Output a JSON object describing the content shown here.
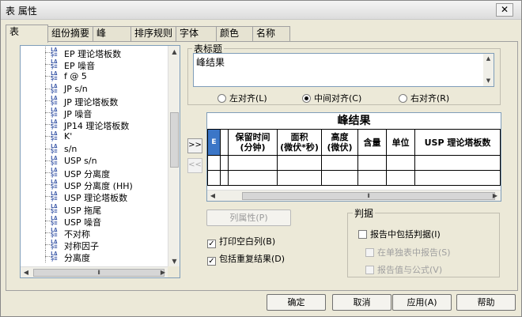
{
  "window": {
    "title": "表 属性",
    "close": "✕"
  },
  "tabs": [
    {
      "label": "表"
    },
    {
      "label": "组份摘要"
    },
    {
      "label": "峰"
    },
    {
      "label": "排序规则"
    },
    {
      "label": "字体"
    },
    {
      "label": "颜色"
    },
    {
      "label": "名称"
    }
  ],
  "tree": {
    "items": [
      {
        "label": "EP 理论塔板数"
      },
      {
        "label": "EP 噪音"
      },
      {
        "label": "f @ 5"
      },
      {
        "label": "JP s/n"
      },
      {
        "label": "JP 理论塔板数"
      },
      {
        "label": "JP 噪音"
      },
      {
        "label": "JP14 理论塔板数"
      },
      {
        "label": "K'"
      },
      {
        "label": "s/n"
      },
      {
        "label": "USP s/n"
      },
      {
        "label": "USP 分离度"
      },
      {
        "label": "USP 分离度 (HH)"
      },
      {
        "label": "USP 理论塔板数"
      },
      {
        "label": "USP 拖尾"
      },
      {
        "label": "USP 噪音"
      },
      {
        "label": "不对称"
      },
      {
        "label": "对称因子"
      },
      {
        "label": "分离度"
      }
    ]
  },
  "table_title": {
    "label": "表标题",
    "value": "峰结果"
  },
  "alignment": {
    "options": [
      {
        "label": "左对齐(L)",
        "selected": false
      },
      {
        "label": "中间对齐(C)",
        "selected": true
      },
      {
        "label": "右对齐(R)",
        "selected": false
      }
    ]
  },
  "arrows": {
    "add": ">>",
    "remove": "<<"
  },
  "grid": {
    "title": "峰结果",
    "selected_marker": "E",
    "headers": [
      "",
      "",
      "保留时间\n(分钟)",
      "面积\n(微伏*秒)",
      "高度\n(微伏)",
      "含量",
      "单位",
      "USP 理论塔板数"
    ]
  },
  "column_props_button": "列属性(P)",
  "options": [
    {
      "label": "打印空白列(B)",
      "checked": true
    },
    {
      "label": "包括重复结果(D)",
      "checked": true
    }
  ],
  "judgement": {
    "title": "判据",
    "include": {
      "label": "报告中包括判据(I)",
      "checked": false
    },
    "separate": {
      "label": "在单独表中报告(S)",
      "checked": false
    },
    "values": {
      "label": "报告值与公式(V)",
      "checked": false
    }
  },
  "footer": {
    "ok": "确定",
    "cancel": "取消",
    "apply": "应用(A)",
    "help": "帮助"
  }
}
